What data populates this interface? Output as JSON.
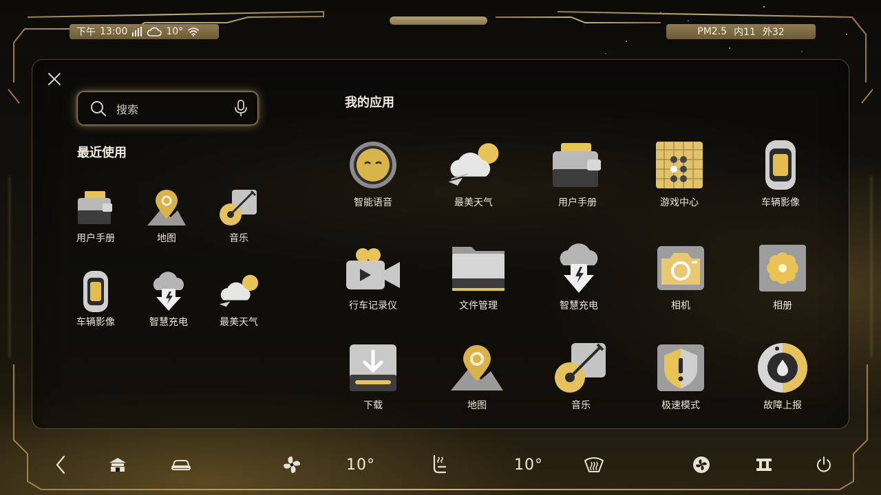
{
  "status": {
    "period": "下午",
    "time": "13:00",
    "signal_icon": "signal-bars-icon",
    "weather_icon": "cloud-sun-icon",
    "temperature": "10°",
    "wifi_icon": "wifi-icon",
    "pm_label": "PM2.5",
    "inside": "内11",
    "outside": "外32"
  },
  "search": {
    "placeholder": "搜索"
  },
  "recent": {
    "title": "最近使用",
    "items": [
      {
        "label": "用户手册",
        "icon": "user-manual-icon"
      },
      {
        "label": "地图",
        "icon": "map-pin-icon"
      },
      {
        "label": "音乐",
        "icon": "music-guitar-icon"
      },
      {
        "label": "车辆影像",
        "icon": "vehicle-camera-icon"
      },
      {
        "label": "智慧充电",
        "icon": "smart-charging-icon"
      },
      {
        "label": "最美天气",
        "icon": "weather-icon"
      }
    ]
  },
  "apps": {
    "title": "我的应用",
    "items": [
      {
        "label": "智能语音",
        "icon": "voice-assistant-icon"
      },
      {
        "label": "最美天气",
        "icon": "weather-icon"
      },
      {
        "label": "用户手册",
        "icon": "user-manual-icon"
      },
      {
        "label": "游戏中心",
        "icon": "game-center-icon"
      },
      {
        "label": "车辆影像",
        "icon": "vehicle-camera-icon"
      },
      {
        "label": "行车记录仪",
        "icon": "dashcam-icon"
      },
      {
        "label": "文件管理",
        "icon": "folder-icon"
      },
      {
        "label": "智慧充电",
        "icon": "smart-charging-icon"
      },
      {
        "label": "相机",
        "icon": "camera-icon"
      },
      {
        "label": "相册",
        "icon": "photo-album-icon"
      },
      {
        "label": "下载",
        "icon": "download-icon"
      },
      {
        "label": "地图",
        "icon": "map-pin-icon"
      },
      {
        "label": "音乐",
        "icon": "music-guitar-icon"
      },
      {
        "label": "极速模式",
        "icon": "speed-mode-shield-icon"
      },
      {
        "label": "故障上报",
        "icon": "fault-report-icon"
      }
    ]
  },
  "bottom_bar": {
    "left_temp": "10°",
    "right_temp": "10°",
    "icons": [
      "back-icon",
      "home-icon",
      "car-icon",
      "fan-icon",
      "seat-heat-icon",
      "defrost-icon",
      "ac-icon",
      "rear-defrost-icon",
      "power-icon"
    ]
  },
  "colors": {
    "gold": "#e2c35a",
    "silver": "#c9c9c9",
    "frame": "#b79a5a",
    "text": "#ece6d8"
  }
}
